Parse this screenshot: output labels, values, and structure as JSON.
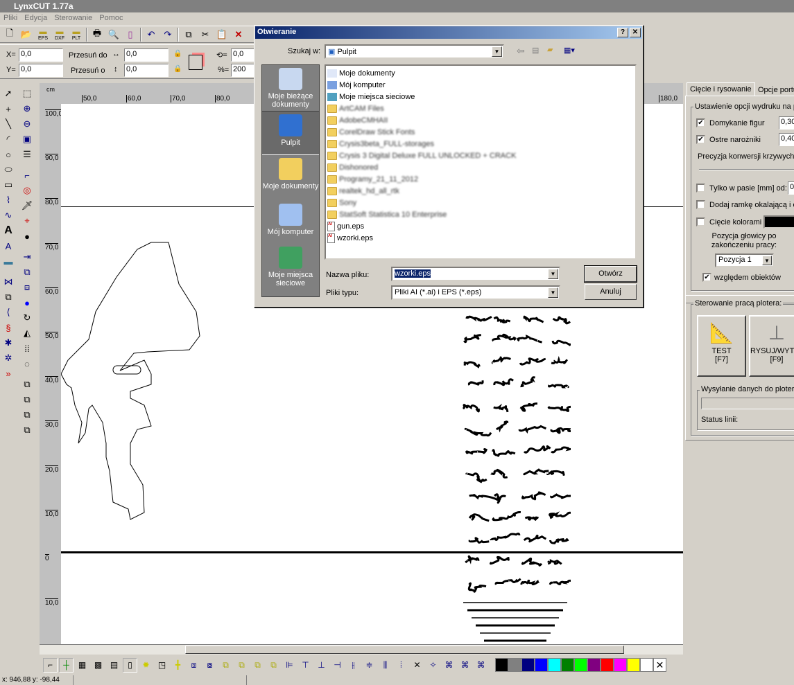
{
  "app": {
    "title": "LynxCUT 1.77a"
  },
  "menu": [
    "Pliki",
    "Edycja",
    "Sterowanie",
    "Pomoc"
  ],
  "toolbar": {
    "icons": [
      "new-file",
      "open-file",
      "open-eps",
      "open-dxf",
      "open-plt",
      "print",
      "print-preview",
      "page-setup",
      "undo",
      "redo",
      "copy",
      "cut",
      "paste",
      "delete"
    ],
    "eps": "EPS",
    "dxf": "DXF",
    "plt": "PLT"
  },
  "props": {
    "x_label": "X=",
    "x_value": "0,0",
    "y_label": "Y=",
    "y_value": "0,0",
    "move_to": "Przesuń do",
    "move_by": "Przesuń o",
    "width_value": "0,0",
    "height_value": "0,0",
    "rotate_label": "⟲=",
    "rotate_value": "0,0",
    "scale_label": "%=",
    "scale_value": "200"
  },
  "ruler": {
    "unit": "cm",
    "h_labels": [
      "50,0",
      "60,0",
      "70,0",
      "80,0",
      "180,0"
    ],
    "v_labels": [
      "100,0",
      "90,0",
      "80,0",
      "70,0",
      "60,0",
      "50,0",
      "40,0",
      "30,0",
      "20,0",
      "10,0",
      "0",
      "10,0"
    ]
  },
  "dialog": {
    "title": "Otwieranie",
    "help": "?",
    "close": "✕",
    "look_in_label": "Szukaj w:",
    "look_in_value": "Pulpit",
    "places": [
      "Moje bieżące dokumenty",
      "Pulpit",
      "Moje dokumenty",
      "Mój komputer",
      "Moje miejsca sieciowe"
    ],
    "files": [
      {
        "name": "Moje dokumenty",
        "type": "mydocs"
      },
      {
        "name": "Mój komputer",
        "type": "computer"
      },
      {
        "name": "Moje miejsca sieciowe",
        "type": "network"
      },
      {
        "name": "ArtCAM Files",
        "type": "folder",
        "blurred": true
      },
      {
        "name": "AdobeCMHAII",
        "type": "folder",
        "blurred": true
      },
      {
        "name": "CorelDraw Stick Fonts",
        "type": "folder",
        "blurred": true
      },
      {
        "name": "Crysis3beta_FULL-storages",
        "type": "folder",
        "blurred": true
      },
      {
        "name": "Crysis 3 Digital Deluxe FULL UNLOCKED + CRACK",
        "type": "folder",
        "blurred": true
      },
      {
        "name": "Dishonored",
        "type": "folder",
        "blurred": true
      },
      {
        "name": "Programy_21_11_2012",
        "type": "folder",
        "blurred": true
      },
      {
        "name": "realtek_hd_all_rtk",
        "type": "folder",
        "blurred": true
      },
      {
        "name": "Sony",
        "type": "folder",
        "blurred": true
      },
      {
        "name": "StatSoft Statistica 10 Enterprise",
        "type": "folder",
        "blurred": true
      },
      {
        "name": "gun.eps",
        "type": "eps"
      },
      {
        "name": "wzorki.eps",
        "type": "eps"
      }
    ],
    "filename_label": "Nazwa pliku:",
    "filename_value": "wzorki.eps",
    "filetype_label": "Pliki typu:",
    "filetype_value": "Pliki AI (*.ai) i EPS (*.eps)",
    "open_button": "Otwórz",
    "cancel_button": "Anuluj"
  },
  "panel": {
    "tabs": [
      "Cięcie i rysowanie",
      "Opcje portu"
    ],
    "print_group": "Ustawienie opcji wydruku na p",
    "close_shapes": {
      "label": "Domykanie figur",
      "checked": true,
      "value": "0,30"
    },
    "sharp_corners": {
      "label": "Ostre narożniki",
      "checked": true,
      "value": "0,40"
    },
    "curve_precision": "Precyzja konwersji krzywych [",
    "strip_only": {
      "label": "Tylko w pasie [mm] od:",
      "checked": false,
      "value": "0"
    },
    "add_frame": {
      "label": "Dodaj ramkę okalającą i o",
      "checked": false
    },
    "color_cut": {
      "label": "Cięcie kolorami",
      "checked": false,
      "color": "#000000"
    },
    "head_pos_label": "Pozycja głowicy po zakończeniu pracy:",
    "head_pos_value": "Pozycja 1",
    "relative": {
      "label": "względem obiektów",
      "checked": true
    },
    "plotter_group": "Sterowanie pracą plotera:",
    "test_button": "TEST",
    "test_key": "[F7]",
    "draw_button": "RYSUJ/WYTNIJ",
    "draw_key": "[F9]",
    "send_group": "Wysyłanie danych do plotera",
    "send_progress": 0,
    "line_status": "Status linii:"
  },
  "bottom": {
    "palette": [
      "#000000",
      "#808080",
      "#000080",
      "#0000ff",
      "#00ffff",
      "#008000",
      "#00ff00",
      "#800080",
      "#ff0000",
      "#ff00ff",
      "#ffff00",
      "#ffffff"
    ],
    "no_color": "✕"
  },
  "status": {
    "coords": "x: 946,88   y: -98,44"
  }
}
